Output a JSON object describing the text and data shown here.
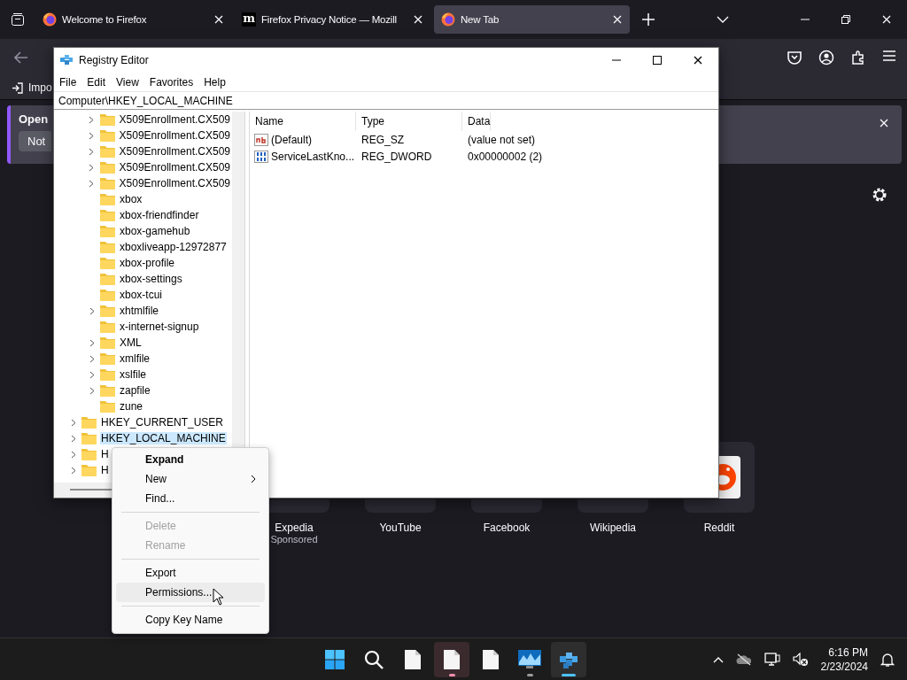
{
  "browser": {
    "tabs": [
      {
        "label": "Welcome to Firefox",
        "selected": false
      },
      {
        "label": "Firefox Privacy Notice — Mozill",
        "icon_text": "m",
        "selected": false
      },
      {
        "label": "New Tab",
        "selected": true
      }
    ],
    "bookmarks_bar": {
      "import_label": "Impo"
    },
    "notification": {
      "title": "Open",
      "button": "Not"
    },
    "shortcuts": [
      {
        "kind": "covered",
        "label": "Expedia",
        "note": "Sponsored"
      },
      {
        "kind": "covered",
        "label": "YouTube"
      },
      {
        "kind": "covered",
        "label": "Facebook"
      },
      {
        "kind": "covered",
        "label": "Wikipedia"
      },
      {
        "kind": "reddit",
        "label": "Reddit"
      }
    ]
  },
  "registry_editor": {
    "title": "Registry Editor",
    "menu": [
      "File",
      "Edit",
      "View",
      "Favorites",
      "Help"
    ],
    "address": "Computer\\HKEY_LOCAL_MACHINE",
    "tree": {
      "subkeys": [
        {
          "label": "X509Enrollment.CX509",
          "expandable": true,
          "selected": false
        },
        {
          "label": "X509Enrollment.CX509",
          "expandable": true,
          "selected": false
        },
        {
          "label": "X509Enrollment.CX509",
          "expandable": true,
          "selected": false
        },
        {
          "label": "X509Enrollment.CX509",
          "expandable": true,
          "selected": false
        },
        {
          "label": "X509Enrollment.CX509",
          "expandable": true,
          "selected": false
        },
        {
          "label": "xbox",
          "expandable": false,
          "selected": false
        },
        {
          "label": "xbox-friendfinder",
          "expandable": false,
          "selected": false
        },
        {
          "label": "xbox-gamehub",
          "expandable": false,
          "selected": false
        },
        {
          "label": "xboxliveapp-12972877",
          "expandable": false,
          "selected": false
        },
        {
          "label": "xbox-profile",
          "expandable": false,
          "selected": false
        },
        {
          "label": "xbox-settings",
          "expandable": false,
          "selected": false
        },
        {
          "label": "xbox-tcui",
          "expandable": false,
          "selected": false
        },
        {
          "label": "xhtmlfile",
          "expandable": true,
          "selected": false
        },
        {
          "label": "x-internet-signup",
          "expandable": false,
          "selected": false
        },
        {
          "label": "XML",
          "expandable": true,
          "selected": false
        },
        {
          "label": "xmlfile",
          "expandable": true,
          "selected": false
        },
        {
          "label": "xslfile",
          "expandable": true,
          "selected": false
        },
        {
          "label": "zapfile",
          "expandable": true,
          "selected": false
        },
        {
          "label": "zune",
          "expandable": false,
          "selected": false
        }
      ],
      "root_keys": [
        {
          "label": "HKEY_CURRENT_USER",
          "expandable": true,
          "selected": false
        },
        {
          "label": "HKEY_LOCAL_MACHINE",
          "expandable": true,
          "selected": true
        },
        {
          "label": "H",
          "expandable": true,
          "selected": false
        },
        {
          "label": "H",
          "expandable": true,
          "selected": false
        }
      ]
    },
    "columns": [
      "Name",
      "Type",
      "Data"
    ],
    "values": [
      {
        "kind": "string",
        "name": "(Default)",
        "type": "REG_SZ",
        "data": "(value not set)"
      },
      {
        "kind": "binary",
        "name": "ServiceLastKno...",
        "type": "REG_DWORD",
        "data": "0x00000002 (2)"
      }
    ]
  },
  "context_menu": [
    {
      "kind": "item",
      "label": "Expand",
      "default": true,
      "disabled": false,
      "hovered": false
    },
    {
      "kind": "submenu",
      "label": "New",
      "default": false,
      "disabled": false,
      "hovered": false
    },
    {
      "kind": "item",
      "label": "Find...",
      "default": false,
      "disabled": false,
      "hovered": false
    },
    {
      "kind": "separator"
    },
    {
      "kind": "item",
      "label": "Delete",
      "default": false,
      "disabled": true,
      "hovered": false
    },
    {
      "kind": "item",
      "label": "Rename",
      "default": false,
      "disabled": true,
      "hovered": false
    },
    {
      "kind": "separator"
    },
    {
      "kind": "item",
      "label": "Export",
      "default": false,
      "disabled": false,
      "hovered": false
    },
    {
      "kind": "item",
      "label": "Permissions...",
      "default": false,
      "disabled": false,
      "hovered": true
    },
    {
      "kind": "separator"
    },
    {
      "kind": "item",
      "label": "Copy Key Name",
      "default": false,
      "disabled": false,
      "hovered": false
    }
  ],
  "taskbar": {
    "apps": [
      {
        "kind": "start",
        "running": false,
        "flashing": false,
        "active": false
      },
      {
        "kind": "search",
        "running": false,
        "flashing": false,
        "active": false
      },
      {
        "kind": "document",
        "running": false,
        "flashing": false,
        "active": false
      },
      {
        "kind": "document",
        "running": true,
        "flashing": true,
        "active": false
      },
      {
        "kind": "document",
        "running": false,
        "flashing": false,
        "active": false
      },
      {
        "kind": "monitor",
        "running": true,
        "flashing": false,
        "active": false
      },
      {
        "kind": "registry",
        "running": true,
        "flashing": false,
        "active": true
      }
    ],
    "time": "6:16 PM",
    "date": "2/23/2024"
  }
}
